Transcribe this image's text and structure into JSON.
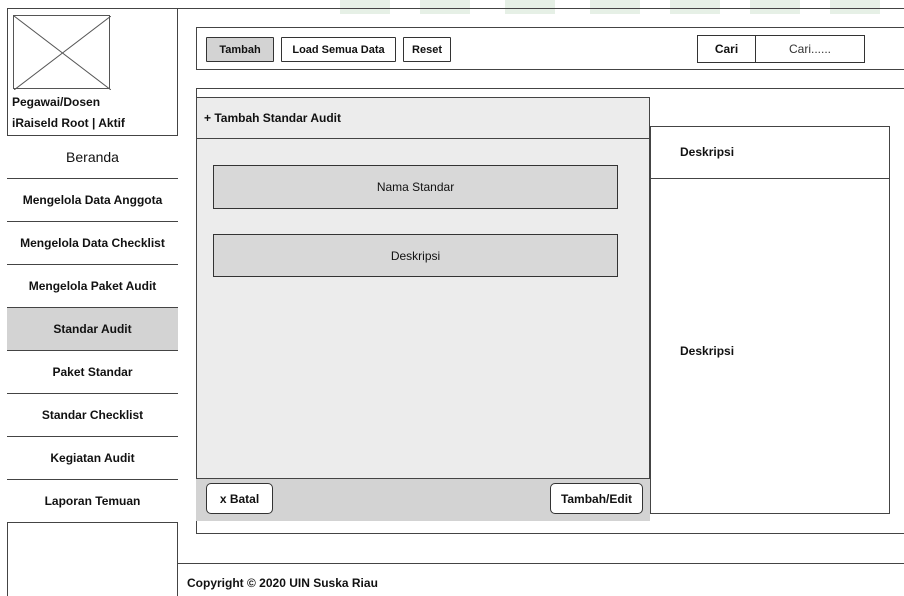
{
  "sidebar": {
    "user_role": "Pegawai/Dosen",
    "user_info": "iRaiseld Root  |  Aktif",
    "items": [
      {
        "label": "Beranda"
      },
      {
        "label": "Mengelola Data Anggota"
      },
      {
        "label": "Mengelola Data Checklist"
      },
      {
        "label": "Mengelola Paket Audit"
      },
      {
        "label": "Standar Audit",
        "active": true
      },
      {
        "label": "Paket Standar"
      },
      {
        "label": "Standar Checklist"
      },
      {
        "label": "Kegiatan Audit"
      },
      {
        "label": "Laporan Temuan"
      }
    ]
  },
  "toolbar": {
    "add_label": "Tambah",
    "load_all_label": "Load Semua Data",
    "reset_label": "Reset",
    "search_label": "Cari",
    "search_placeholder": "Cari......"
  },
  "dialog": {
    "title": "+ Tambah Standar Audit",
    "name_field": "Nama Standar",
    "description_field": "Deskripsi",
    "cancel_label": "x Batal",
    "submit_label": "Tambah/Edit"
  },
  "detail": {
    "header": "Deskripsi",
    "body": "Deskripsi"
  },
  "footer": {
    "copyright": "Copyright © 2020 UIN Suska Riau"
  },
  "colors": {
    "active_nav": "#d3d3d3",
    "dialog_bg": "#ececec",
    "field_bg": "#d8d8d8",
    "border": "#444444"
  }
}
